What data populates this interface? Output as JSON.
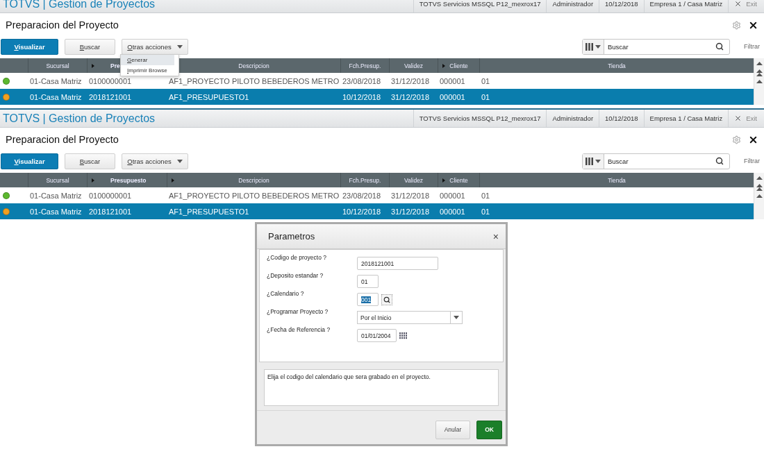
{
  "screens": [
    {
      "title_bar": {
        "app": "TOTVS | Gestion de Proyectos",
        "info": [
          "TOTVS Servicios MSSQL P12_mexrox17",
          "Administrador",
          "10/12/2018",
          "Empresa 1 / Casa Matriz"
        ],
        "exit": "Exit"
      },
      "page_title": "Preparacion del Proyecto",
      "buttons": [
        {
          "label": "Visualizar",
          "kind": "primary"
        },
        {
          "label": "Buscar",
          "kind": "plain"
        },
        {
          "label": "Otras acciones",
          "kind": "dropdown"
        }
      ],
      "actions_menu": {
        "items": [
          {
            "label": "Generar",
            "selected": true
          },
          {
            "label": "Imprimir Browse",
            "selected": false
          }
        ]
      },
      "search": {
        "value": "Buscar"
      },
      "filter_link": "Filtrar",
      "table": {
        "columns": [
          {
            "label": "Sucursal",
            "marker": false,
            "sorted": false
          },
          {
            "label": "Pre",
            "marker": true,
            "sorted": true
          },
          {
            "label": "Descripcion",
            "sorted": false
          },
          {
            "label": "Fch.Presup.",
            "marker": false,
            "sorted": false
          },
          {
            "label": "Validez",
            "marker": false,
            "sorted": false
          },
          {
            "label": "Cliente",
            "marker": true,
            "sorted": false
          },
          {
            "label": "Tienda",
            "marker": false,
            "sorted": false
          }
        ],
        "rows": [
          {
            "color": "#5cb82e",
            "selected": false,
            "cells": [
              "01-Casa Matriz",
              "0100000001",
              "AF1_PROYECTO PILOTO BEBEDEROS METRO",
              "23/08/2018",
              "31/12/2018",
              "000001",
              "01"
            ]
          },
          {
            "color": "#f0a020",
            "selected": true,
            "cells": [
              "01-Casa Matriz",
              "2018121001",
              "AF1_PRESUPUESTO1",
              "10/12/2018",
              "31/12/2018",
              "000001",
              "01"
            ]
          }
        ]
      }
    },
    {
      "title_bar": {
        "app": "TOTVS | Gestion de Proyectos",
        "info": [
          "TOTVS Servicios MSSQL P12_mexrox17",
          "Administrador",
          "10/12/2018",
          "Empresa 1 / Casa Matriz"
        ],
        "exit": "Exit"
      },
      "page_title": "Preparacion del Proyecto",
      "buttons": [
        {
          "label": "Visualizar",
          "kind": "primary"
        },
        {
          "label": "Buscar",
          "kind": "plain"
        },
        {
          "label": "Otras acciones",
          "kind": "dropdown"
        }
      ],
      "search": {
        "value": "Buscar"
      },
      "filter_link": "Filtrar",
      "table": {
        "columns": [
          {
            "label": "Sucursal",
            "marker": false,
            "sorted": false
          },
          {
            "label": "Presupuesto",
            "marker": true,
            "sorted": true
          },
          {
            "label": "Descripcion",
            "marker": true,
            "sorted": false
          },
          {
            "label": "Fch.Presup.",
            "marker": false,
            "sorted": false
          },
          {
            "label": "Validez",
            "marker": false,
            "sorted": false
          },
          {
            "label": "Cliente",
            "marker": true,
            "sorted": false
          },
          {
            "label": "Tienda",
            "marker": false,
            "sorted": false
          }
        ],
        "rows": [
          {
            "color": "#5cb82e",
            "selected": false,
            "cells": [
              "01-Casa Matriz",
              "0100000001",
              "AF1_PROYECTO PILOTO BEBEDEROS METRO",
              "23/08/2018",
              "31/12/2018",
              "000001",
              "01"
            ]
          },
          {
            "color": "#f0a020",
            "selected": true,
            "cells": [
              "01-Casa Matriz",
              "2018121001",
              "AF1_PRESUPUESTO1",
              "10/12/2018",
              "31/12/2018",
              "000001",
              "01"
            ]
          }
        ]
      }
    }
  ],
  "dialog": {
    "title": "Parametros",
    "close": "×",
    "fields": [
      {
        "label": "¿Codigo de proyecto ?",
        "value": "2018121001",
        "kind": "text",
        "text_selected": false
      },
      {
        "label": "¿Deposito estandar ?",
        "value": "01",
        "kind": "short",
        "text_selected": false
      },
      {
        "label": "¿Calendario ?",
        "value": "001",
        "kind": "lookup",
        "text_selected": true
      },
      {
        "label": "¿Programar Proyecto ?",
        "value": "Por el Inicio",
        "kind": "select",
        "text_selected": false
      },
      {
        "label": "¿Fecha de Referencia ?",
        "value": "01/01/2004",
        "kind": "date",
        "text_selected": false
      }
    ],
    "help": "Elija el codigo del calendario que sera grabado en el proyecto.",
    "buttons": [
      {
        "label": "Anular",
        "kind": "secondary"
      },
      {
        "label": "OK",
        "kind": "primary"
      }
    ]
  }
}
